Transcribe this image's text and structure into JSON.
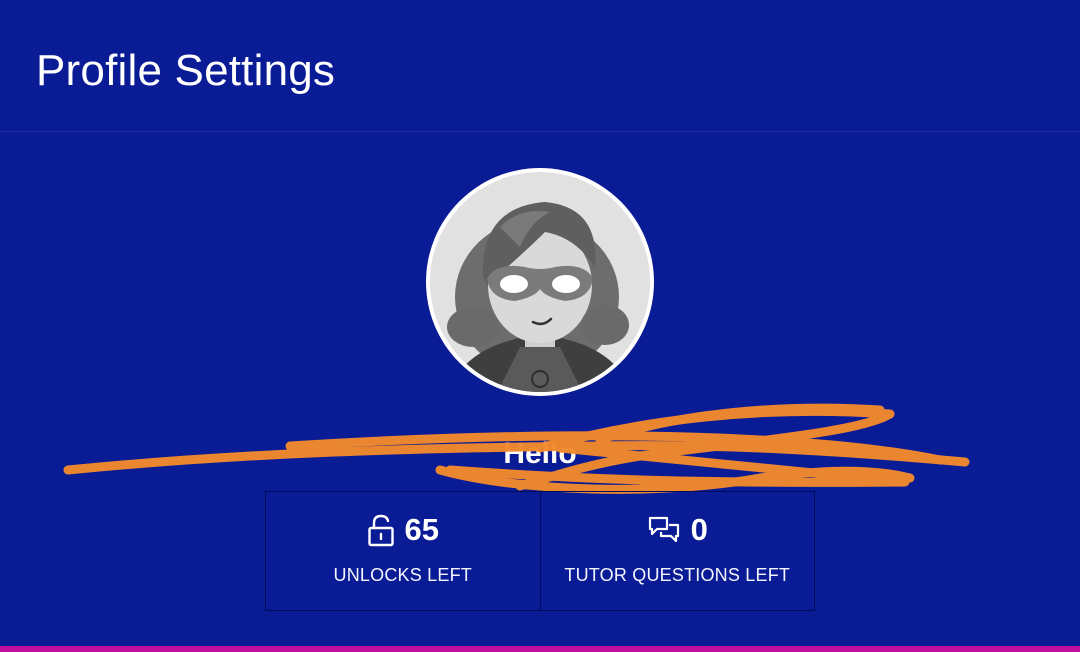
{
  "header": {
    "title": "Profile Settings"
  },
  "profile": {
    "avatar_icon": "masked-character-avatar",
    "greeting": "Hello"
  },
  "stats": {
    "unlocks": {
      "value": "65",
      "label": "UNLOCKS LEFT",
      "icon": "unlock-icon"
    },
    "tutor": {
      "value": "0",
      "label": "TUTOR QUESTIONS LEFT",
      "icon": "chat-bubbles-icon"
    }
  },
  "colors": {
    "background": "#0a1b96",
    "accent_bar": "#c10fa0",
    "redaction_scribble": "#f28a2c"
  }
}
